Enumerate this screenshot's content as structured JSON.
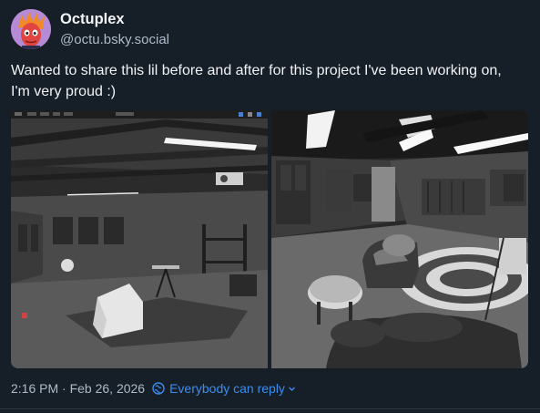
{
  "post": {
    "author": {
      "display_name": "Octuplex",
      "handle": "@octu.bsky.social",
      "avatar_icon": "avatar-icon"
    },
    "text": "Wanted to share this lil before and after for this project I've been working on, I'm very proud :)",
    "media": [
      {
        "kind": "image",
        "description_icon": "blender-viewport-image"
      },
      {
        "kind": "image",
        "description_icon": "rendered-room-image"
      }
    ],
    "timestamp": "2:16 PM · Feb 26, 2026",
    "reply_setting": {
      "label": "Everybody can reply",
      "icon": "globe-icon"
    }
  },
  "theme": {
    "background": "#161e27",
    "text": "#f1f3f5",
    "muted": "#aebbc9",
    "accent": "#3b8df0"
  }
}
